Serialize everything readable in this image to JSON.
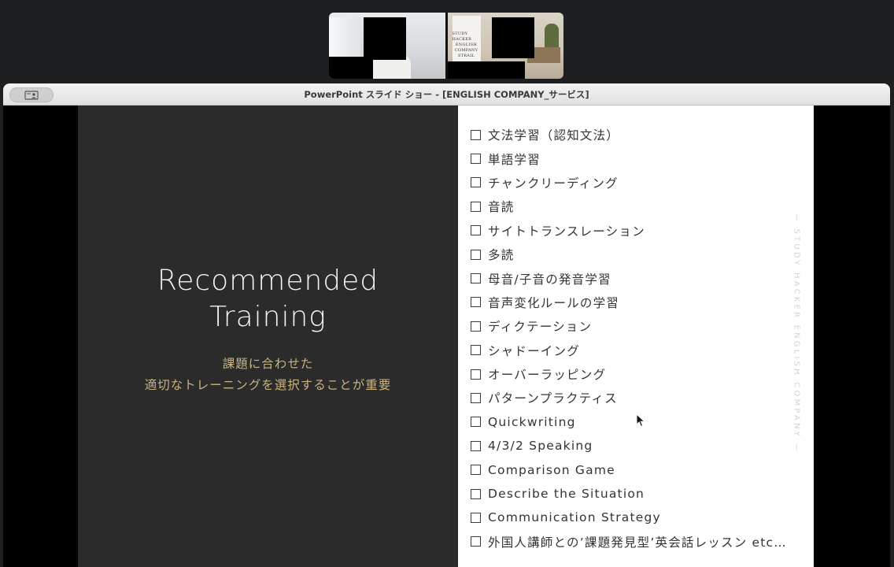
{
  "video": {
    "poster_lines": [
      "STUDY HACKER",
      "ENGLISH",
      "COMPANY",
      "STRAIL"
    ]
  },
  "window": {
    "title": "PowerPoint スライド ショー - [ENGLISH COMPANY_サービス]",
    "left_button_icon": "presenter-view-icon"
  },
  "slide": {
    "heading_line1": "Recommended",
    "heading_line2": "Training",
    "subtitle_line1": "課題に合わせた",
    "subtitle_line2": "適切なトレーニングを選択することが重要",
    "vertical_mark": "— STUDY HACKER ENGLISH COMPANY —",
    "checklist": [
      "文法学習（認知文法）",
      "単語学習",
      "チャンクリーディング",
      "音読",
      "サイトトランスレーション",
      "多読",
      "母音/子音の発音学習",
      "音声変化ルールの学習",
      "ディクテーション",
      "シャドーイング",
      "オーバーラッピング",
      "パターンプラクティス",
      "Quickwriting",
      "4/3/2 Speaking",
      "Comparison Game",
      "Describe the Situation",
      "Communication Strategy",
      "外国人講師との’課題発見型’英会話レッスン etc…"
    ]
  },
  "colors": {
    "slide_dark": "#2b2b2c",
    "accent_gold": "#c9b27e",
    "titlebar": "#e6e6e6"
  }
}
